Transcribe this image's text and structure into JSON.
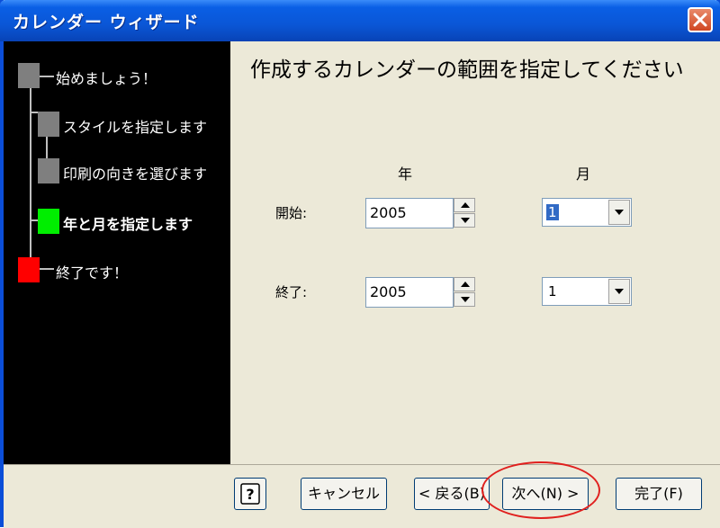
{
  "window": {
    "title": "カレンダー ウィザード"
  },
  "steps": [
    {
      "label": "始めましょう！",
      "color": "#7f7f7f",
      "state": "done"
    },
    {
      "label": "スタイルを指定します",
      "color": "#7f7f7f",
      "state": "done"
    },
    {
      "label": "印刷の向きを選びます",
      "color": "#7f7f7f",
      "state": "done"
    },
    {
      "label": "年と月を指定します",
      "color": "#00ee00",
      "state": "current"
    },
    {
      "label": "終了です！",
      "color": "#ff0000",
      "state": "pending"
    }
  ],
  "main": {
    "heading": "作成するカレンダーの範囲を指定してください",
    "col_year": "年",
    "col_month": "月",
    "start": {
      "label": "開始:",
      "year": "2005",
      "month": "1"
    },
    "end": {
      "label": "終了:",
      "year": "2005",
      "month": "1"
    }
  },
  "buttons": {
    "help": "?",
    "cancel": "キャンセル",
    "back": "< 戻る(B)",
    "next": "次へ(N) >",
    "finish": "完了(F)"
  },
  "colors": {
    "titlebar": "#0a56d6",
    "annotation": "#e0201e"
  }
}
